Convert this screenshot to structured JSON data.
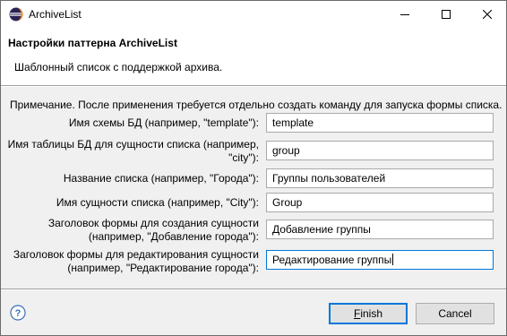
{
  "window": {
    "title": "ArchiveList",
    "icon": "eclipse-icon",
    "controls": {
      "minimize": "minimize-icon",
      "maximize": "maximize-icon",
      "close": "close-icon"
    }
  },
  "header": {
    "title": "Настройки паттерна ArchiveList",
    "description": "Шаблонный список с поддержкой архива."
  },
  "note": "Примечание. После применения требуется отдельно создать команду для запуска формы списка.",
  "fields": [
    {
      "label_lines": [
        "Имя схемы БД (например, \"template\"):"
      ],
      "value": "template"
    },
    {
      "label_lines": [
        "Имя таблицы БД для сущности списка (например,",
        "\"city\"):"
      ],
      "value": "group"
    },
    {
      "label_lines": [
        "Название списка (например, \"Города\"):"
      ],
      "value": "Группы пользователей"
    },
    {
      "label_lines": [
        "Имя сущности списка (например, \"City\"):"
      ],
      "value": "Group"
    },
    {
      "label_lines": [
        "Заголовок формы для создания сущности",
        "(например, \"Добавление города\"):"
      ],
      "value": "Добавление группы"
    },
    {
      "label_lines": [
        "Заголовок формы для редактирования сущности",
        "(например, \"Редактирование города\"):"
      ],
      "value": "Редактирование группы"
    }
  ],
  "buttons": {
    "finish_first": "F",
    "finish_rest": "inish",
    "cancel": "Cancel",
    "help": "help-icon"
  },
  "colors": {
    "focus_border": "#0078d7",
    "dialog_bg": "#f0f0f0",
    "button_bg": "#e1e1e1"
  }
}
